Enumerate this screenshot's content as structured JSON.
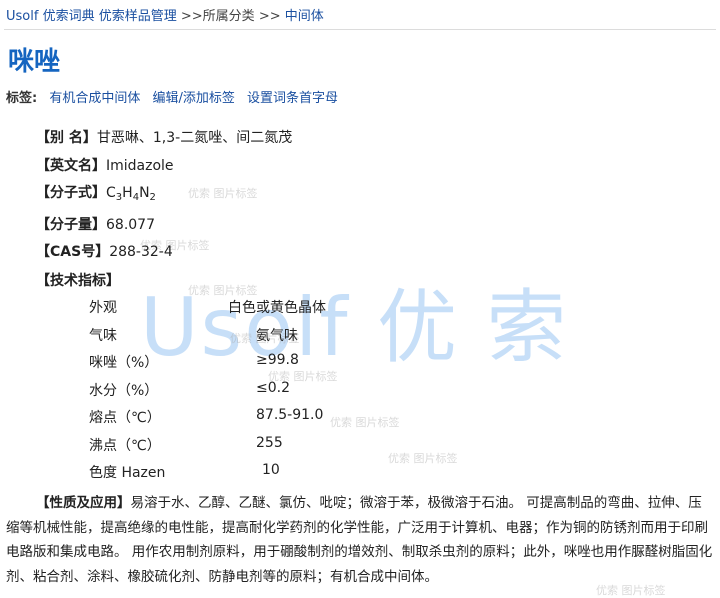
{
  "breadcrumb": {
    "site": "Usolf 优索词典",
    "section": "优索样品管理",
    "sep1": ">>",
    "category": "所属分类",
    "sep2": ">>",
    "current": "中间体"
  },
  "title": "咪唑",
  "tags": {
    "label": "标签:",
    "items": [
      "有机合成中间体",
      "编辑/添加标签",
      "设置词条首字母"
    ]
  },
  "watermark": {
    "big": "Usolf 优 索",
    "small": "优索 图片标签"
  },
  "fields": {
    "alias": {
      "label": "【别  名】",
      "value": "甘恶啉、1,3-二氮唑、间二氮茂"
    },
    "english": {
      "label": "【英文名】",
      "value": "Imidazole"
    },
    "formula": {
      "label": "【分子式】",
      "c": "C",
      "c_n": "3",
      "h": "H",
      "h_n": "4",
      "n": "N",
      "n_n": "2"
    },
    "weight": {
      "label": "【分子量】",
      "value": "68.077"
    },
    "cas": {
      "label": "【CAS号】",
      "value": "288-32-4"
    },
    "tech": {
      "label": "【技术指标】"
    }
  },
  "specs": [
    {
      "key": "外观",
      "value": "白色或黄色晶体"
    },
    {
      "key": "气味",
      "value": "氨气味"
    },
    {
      "key": "咪唑（%）",
      "value": "≥99.8"
    },
    {
      "key": "水分（%）",
      "value": "≤0.2"
    },
    {
      "key": "熔点（℃）",
      "value": "87.5-91.0"
    },
    {
      "key": "沸点（℃）",
      "value": "255"
    },
    {
      "key": "色度 Hazen",
      "value": "10"
    }
  ],
  "usage": {
    "label": "【性质及应用】",
    "text": "易溶于水、乙醇、乙醚、氯仿、吡啶；微溶于苯，极微溶于石油。 可提高制品的弯曲、拉伸、压缩等机械性能，提高绝缘的电性能，提高耐化学药剂的化学性能，广泛用于计算机、电器；作为铜的防锈剂而用于印刷电路版和集成电路。 用作农用制剂原料，用于硼酸制剂的增效剂、制取杀虫剂的原料；此外，咪唑也用作脲醛树脂固化剂、粘合剂、涂料、橡胶硫化剂、防静电剂等的原料；有机合成中间体。"
  }
}
